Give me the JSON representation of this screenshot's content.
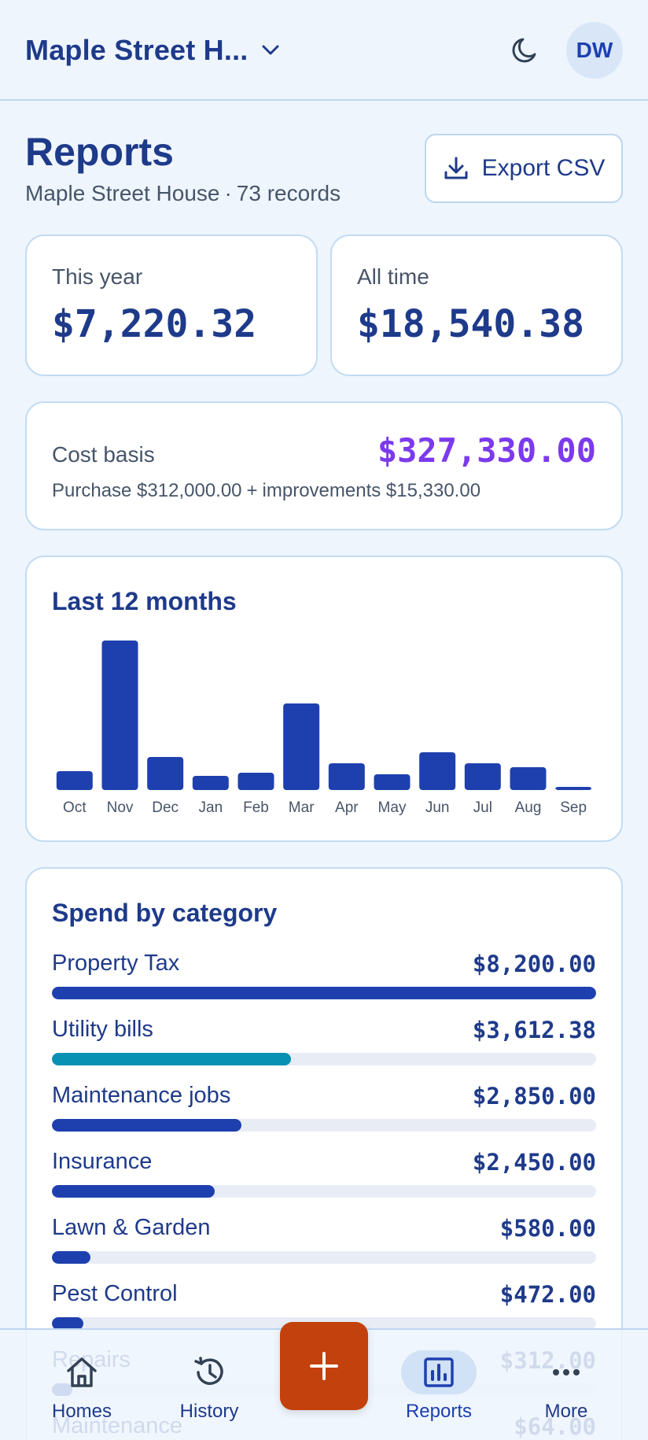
{
  "header": {
    "home_name": "Maple Street H...",
    "avatar_initials": "DW",
    "theme_icon": "moon-icon",
    "switch_icon": "chevron-down-icon"
  },
  "page": {
    "title": "Reports",
    "subtitle_home": "Maple Street House",
    "subtitle_sep": "·",
    "subtitle_records": "73 records",
    "export_label": "Export CSV"
  },
  "stats": {
    "this_year_label": "This year",
    "this_year_value": "$7,220.32",
    "all_time_label": "All time",
    "all_time_value": "$18,540.38"
  },
  "cost_basis": {
    "label": "Cost basis",
    "value": "$327,330.00",
    "purchase": "Purchase $312,000.00",
    "plus": "+",
    "improvements": "improvements $15,330.00"
  },
  "chart_data": {
    "type": "bar",
    "title": "Last 12 months",
    "categories": [
      "Oct",
      "Nov",
      "Dec",
      "Jan",
      "Feb",
      "Mar",
      "Apr",
      "May",
      "Jun",
      "Jul",
      "Aug",
      "Sep"
    ],
    "values": [
      240,
      1900,
      420,
      180,
      220,
      1100,
      340,
      200,
      480,
      340,
      290,
      40
    ],
    "color": "#1e40af"
  },
  "categories": {
    "title": "Spend by category",
    "items": [
      {
        "name": "Property Tax",
        "amount": "$8,200.00",
        "fraction": 1.0,
        "color": "#1e40af"
      },
      {
        "name": "Utility bills",
        "amount": "$3,612.38",
        "fraction": 0.44,
        "color": "#0891b2"
      },
      {
        "name": "Maintenance jobs",
        "amount": "$2,850.00",
        "fraction": 0.348,
        "color": "#1e40af"
      },
      {
        "name": "Insurance",
        "amount": "$2,450.00",
        "fraction": 0.299,
        "color": "#1e40af"
      },
      {
        "name": "Lawn & Garden",
        "amount": "$580.00",
        "fraction": 0.071,
        "color": "#1e40af"
      },
      {
        "name": "Pest Control",
        "amount": "$472.00",
        "fraction": 0.058,
        "color": "#1e40af"
      },
      {
        "name": "Repairs",
        "amount": "$312.00",
        "fraction": 0.038,
        "color": "#1e40af"
      },
      {
        "name": "Maintenance",
        "amount": "$64.00",
        "fraction": 0.008,
        "color": "#1e40af"
      }
    ]
  },
  "nav": {
    "items": [
      {
        "label": "Homes",
        "icon": "home-icon"
      },
      {
        "label": "History",
        "icon": "history-icon"
      },
      {
        "label": "Reports",
        "icon": "bar-chart-icon",
        "active": true
      },
      {
        "label": "More",
        "icon": "more-icon"
      }
    ],
    "fab_icon": "plus-icon"
  },
  "colors": {
    "accent": "#1e40af",
    "basis": "#7c3aed",
    "fab": "#c2410c",
    "background": "#eef5fd"
  }
}
